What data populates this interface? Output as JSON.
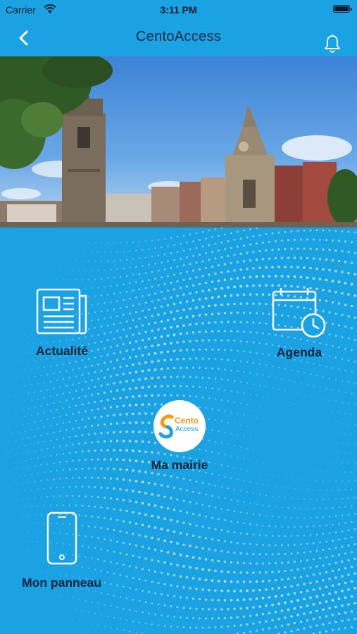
{
  "status_bar": {
    "carrier": "Carrier",
    "time": "3:11 PM"
  },
  "nav": {
    "title": "CentoAccess",
    "back_icon": "chevron-left-icon",
    "bell_icon": "bell-icon"
  },
  "tiles": {
    "actualite": {
      "label": "Actualité",
      "icon": "newspaper-icon"
    },
    "agenda": {
      "label": "Agenda",
      "icon": "calendar-clock-icon"
    },
    "mairie": {
      "label": "Ma mairie",
      "logo_line1": "Cento",
      "logo_line2": "Access",
      "icon": "cento-access-logo"
    },
    "panneau": {
      "label": "Mon panneau",
      "icon": "smartphone-icon"
    }
  },
  "colors": {
    "background": "#1ba2e2",
    "text": "#10223a",
    "icon_stroke": "#ffffff",
    "logo_orange": "#f39c12"
  }
}
